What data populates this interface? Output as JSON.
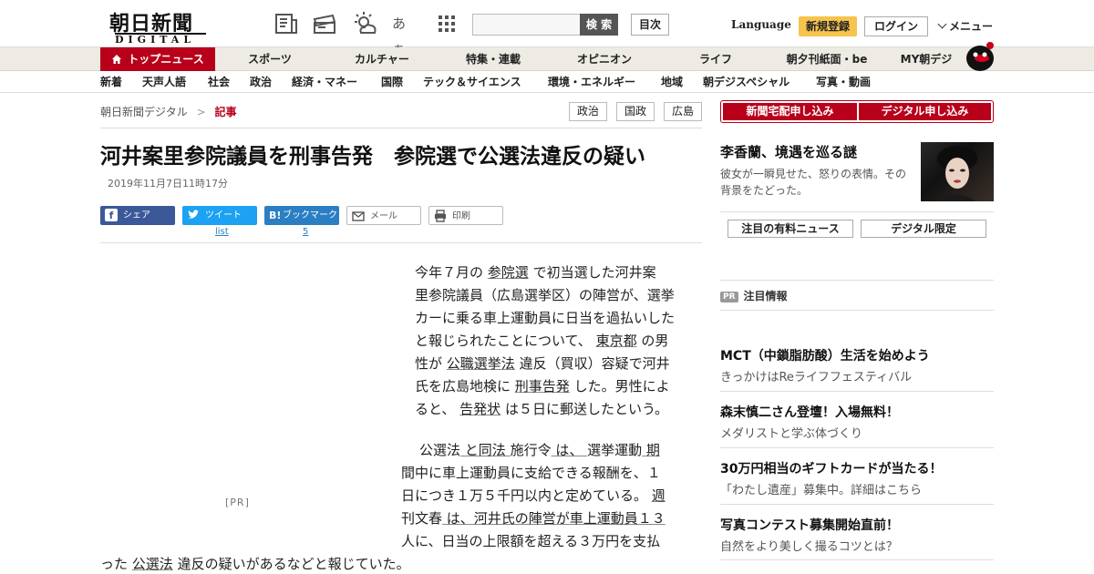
{
  "header": {
    "logo_kanji": "朝日新聞",
    "logo_sub": "DIGITAL",
    "icons": [
      "newspaper-icon",
      "ticket-icon",
      "weather-icon",
      "font-size-icon",
      "apps-grid-icon"
    ],
    "font_label": "あぁ",
    "search_placeholder": "",
    "search_label": "検 索",
    "toc_label": "目次",
    "language_label": "Language",
    "register_label": "新規登録",
    "login_label": "ログイン",
    "menu_label": "メニュー"
  },
  "nav1": {
    "items": [
      "トップニュース",
      "スポーツ",
      "カルチャー",
      "特集・連載",
      "オピニオン",
      "ライフ",
      "朝夕刊紙面・be",
      "MY朝デジ"
    ]
  },
  "nav2": {
    "items": [
      "新着",
      "天声人語",
      "社会",
      "政治",
      "経済・マネー",
      "国際",
      "テック＆サイエンス",
      "環境・エネルギー",
      "地域",
      "朝デジスペシャル",
      "写真・動画"
    ]
  },
  "breadcrumb": {
    "home": "朝日新聞デジタル",
    "separator": ">",
    "current": "記事"
  },
  "tags": [
    "政治",
    "国政",
    "広島"
  ],
  "article": {
    "headline": "河井案里参院議員を刑事告発　参院選で公選法違反の疑い",
    "timestamp": "2019年11月7日11時17分",
    "share": {
      "facebook": "シェア",
      "twitter": "ツイート",
      "twitter_sub": "list",
      "hatena": "ブックマーク",
      "hatena_count": "5",
      "mail": "メール",
      "print": "印刷"
    },
    "pr_mark": "[PR]",
    "para1_lines": [
      [
        "今年７月の ",
        "参院選",
        " で初当選した河井案"
      ],
      [
        "里参院議員（広島選挙区）の陣営が、選挙"
      ],
      [
        "カーに乗る車上運動員に日当を過払いした"
      ],
      [
        "と報じられたことについて、 ",
        "東京都",
        " の男"
      ],
      [
        "性が ",
        "公職選挙法",
        " 違反（買収）容疑で河井"
      ],
      [
        "氏を広島地検に ",
        "刑事告発",
        " した。男性によ"
      ],
      [
        "ると、 ",
        "告発状",
        " は５日に郵送したという。"
      ]
    ],
    "para2_lines": [
      [
        "公選法",
        " と同法 ",
        "施行令",
        " は、 ",
        "選挙運動",
        " 期"
      ],
      [
        "間中に車上運動員に支給できる報酬を、１"
      ],
      [
        "日につき１万５千円以内と定めている。 ",
        "週"
      ],
      [
        "刊文春",
        " は、河井氏の陣営が車上運動員１３"
      ],
      [
        "人に、日当の上限額を超える３万円を支払"
      ],
      [
        "った ",
        "公選法",
        " 違反の疑いがあるなどと報じていた。"
      ]
    ]
  },
  "sidebar": {
    "apply_newspaper": "新聞宅配申し込み",
    "apply_digital": "デジタル申し込み",
    "feature_title": "李香蘭、境遇を巡る謎",
    "feature_desc": "彼女が一瞬見せた、怒りの表情。その背景をたどった。",
    "tab_paid": "注目の有料ニュース",
    "tab_digital": "デジタル限定",
    "pr_badge": "PR",
    "pr_heading": "注目情報",
    "pr_items": [
      {
        "title": "MCT（中鎖脂肪酸）生活を始めよう",
        "sub": "きっかけはReライフフェスティバル"
      },
      {
        "title": "森末慎二さん登壇！入場無料！",
        "sub": "メダリストと学ぶ体づくり"
      },
      {
        "title": "30万円相当のギフトカードが当たる！",
        "sub": "「わたし遺産」募集中。詳細はこちら"
      },
      {
        "title": "写真コンテスト募集開始直前！",
        "sub": "自然をより美しく撮るコツとは？"
      }
    ]
  },
  "colors": {
    "brand_red": "#b8001b",
    "nav_bg": "#eeebe4",
    "register_yellow": "#f6c34c"
  }
}
